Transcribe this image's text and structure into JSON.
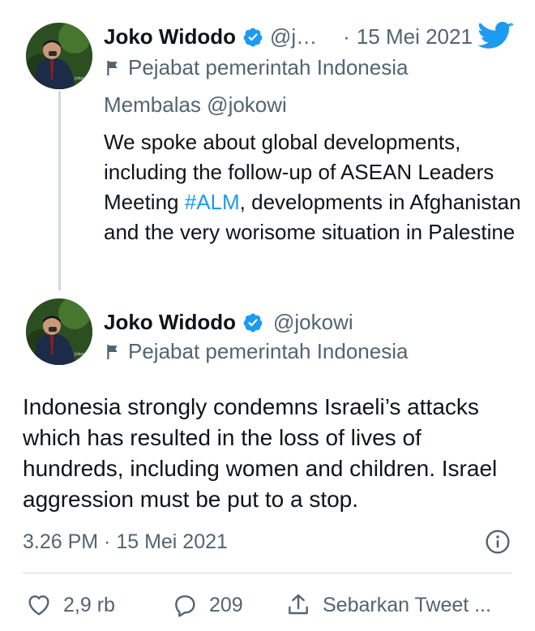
{
  "parent_tweet": {
    "author_name": "Joko Widodo",
    "handle": "@j…",
    "date_sep": "·",
    "date": "15 Mei 2021",
    "label": "Pejabat pemerintah Indonesia",
    "replying_prefix": "Membalas",
    "replying_to": "@jokowi",
    "text_before_hashtag": "We spoke about global developments, including the follow-up of ASEAN Leaders Meeting ",
    "hashtag": "#ALM",
    "text_after_hashtag": ", developments in Afghanistan and the very worisome situation in Palestine"
  },
  "main_tweet": {
    "author_name": "Joko Widodo",
    "handle": "@jokowi",
    "label": "Pejabat pemerintah Indonesia",
    "text": "Indonesia strongly condemns Israeli’s attacks which has resulted in the loss of lives of hundreds, including women and children. Israel aggression must be put to a stop.",
    "timestamp": "3.26 PM · 15 Mei 2021"
  },
  "actions": {
    "likes": "2,9 rb",
    "replies": "209",
    "share_label": "Sebarkan Tweet ..."
  },
  "colors": {
    "accent": "#1d9bf0",
    "text": "#0f1419",
    "muted": "#536471",
    "line": "#cfd9de"
  },
  "icons": [
    "twitter-bird-icon",
    "verified-badge-icon",
    "flag-icon",
    "info-icon",
    "heart-icon",
    "reply-icon",
    "share-icon"
  ]
}
